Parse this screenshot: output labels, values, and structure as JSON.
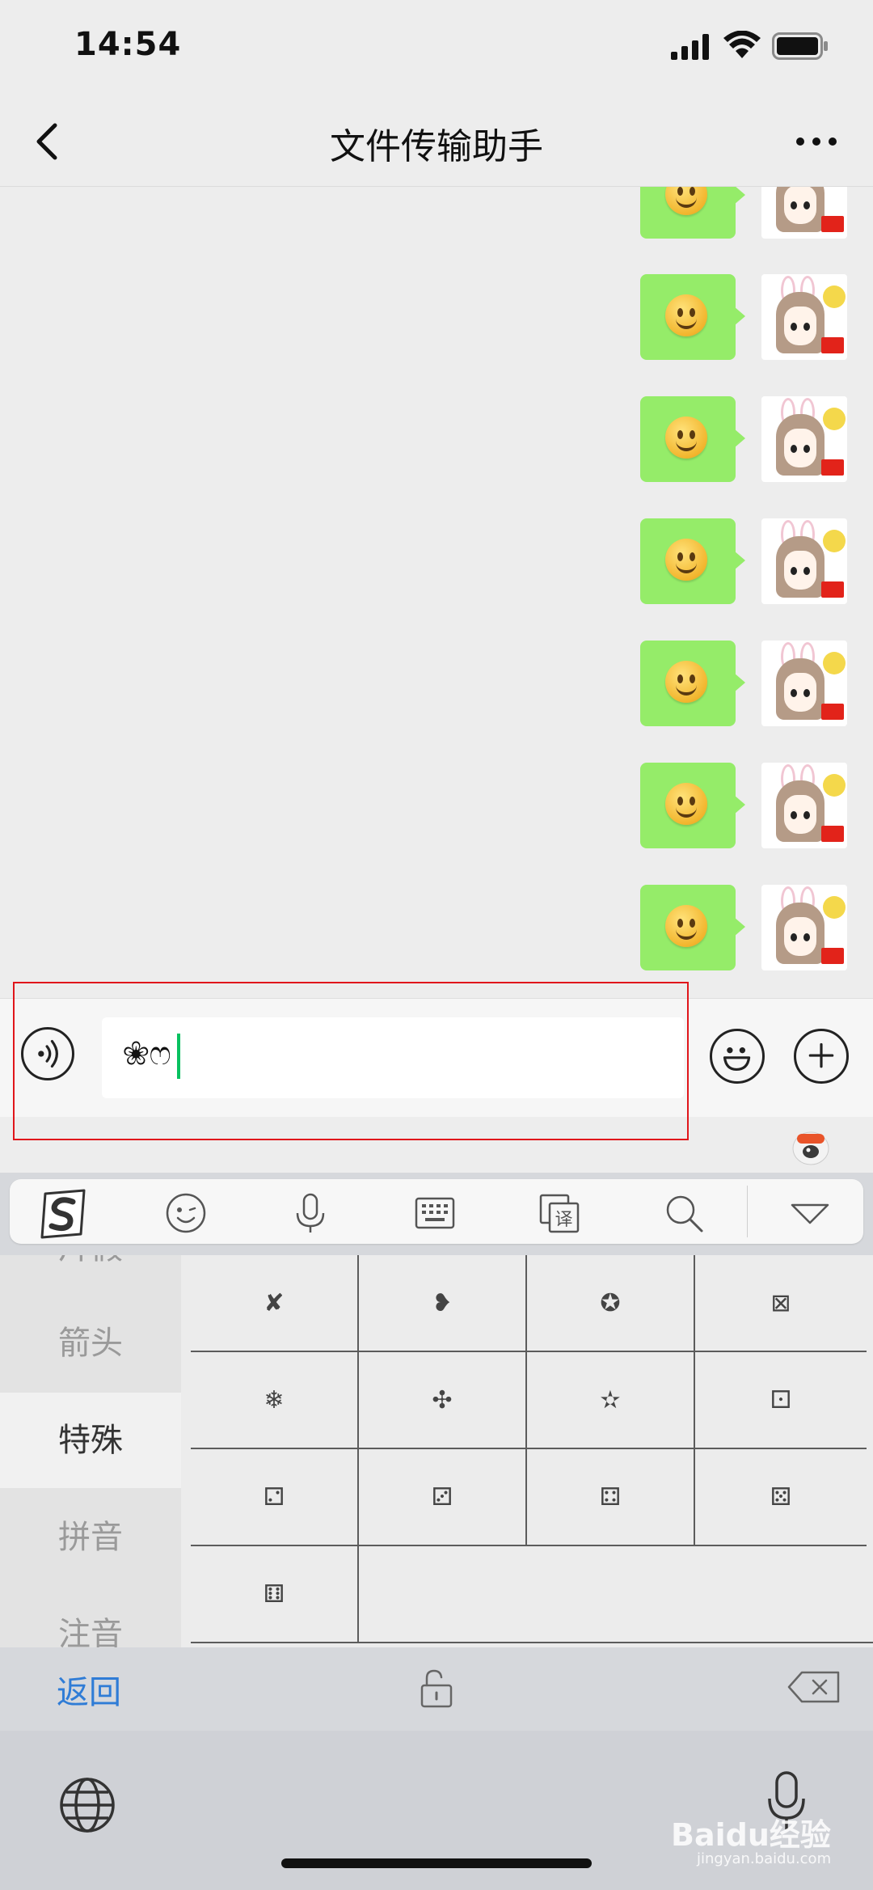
{
  "status_bar": {
    "time": "14:54",
    "icons": [
      "signal-icon",
      "wifi-icon",
      "battery-icon"
    ]
  },
  "nav": {
    "title": "文件传输助手",
    "back_icon": "chevron-left-icon",
    "more_icon": "more-icon"
  },
  "chat": {
    "message_count_visible": 7,
    "bubble_color": "#95ec69",
    "message_content": "smiley-emoji"
  },
  "input": {
    "value": "❀ෆ",
    "caret_color": "#07c160"
  },
  "ime_toolbar": {
    "icons": [
      "sogou-logo-icon",
      "emoji-face-icon",
      "microphone-icon",
      "keyboard-icon",
      "clipboard-translate-icon",
      "search-icon",
      "collapse-triangle-icon"
    ],
    "translate_glyph": "译"
  },
  "symbol_categories": [
    {
      "label": "片假"
    },
    {
      "label": "箭头"
    },
    {
      "label": "特殊",
      "active": true
    },
    {
      "label": "拼音"
    },
    {
      "label": "注音"
    }
  ],
  "symbols": [
    "✘",
    "❥",
    "✪",
    "⊠",
    "❄",
    "✣",
    "✫",
    "⚀",
    "⚁",
    "⚂",
    "⚃",
    "⚄",
    "⚅"
  ],
  "keyboard": {
    "back_label": "返回"
  },
  "watermark": {
    "brand": "Baidu经验",
    "url": "jingyan.baidu.com"
  },
  "colors": {
    "highlight": "#e0161b",
    "accent_blue": "#2f7cd6"
  }
}
